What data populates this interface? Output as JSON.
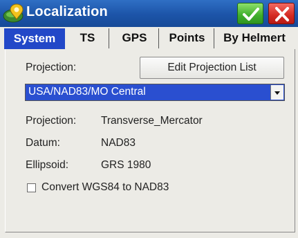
{
  "window": {
    "title": "Localization",
    "icon": "globe-pin-icon",
    "ok_icon": "checkmark-icon",
    "close_icon": "close-icon"
  },
  "tabs": [
    {
      "label": "System",
      "active": true
    },
    {
      "label": "TS",
      "active": false
    },
    {
      "label": "GPS",
      "active": false
    },
    {
      "label": "Points",
      "active": false
    },
    {
      "label": "By Helmert",
      "active": false
    }
  ],
  "system": {
    "projection_label": "Projection:",
    "edit_button_label": "Edit Projection List",
    "projection_selected": "USA/NAD83/MO Central",
    "details": [
      {
        "label": "Projection:",
        "value": "Transverse_Mercator"
      },
      {
        "label": "Datum:",
        "value": "NAD83"
      },
      {
        "label": "Ellipsoid:",
        "value": "GRS 1980"
      }
    ],
    "convert_checkbox": {
      "label": "Convert WGS84 to NAD83",
      "checked": false
    }
  },
  "colors": {
    "titlebar": "#1c54a8",
    "active_tab": "#2248c8",
    "selection": "#2a4fd0",
    "ok_green": "#3fae2c",
    "close_red": "#d42a22"
  }
}
